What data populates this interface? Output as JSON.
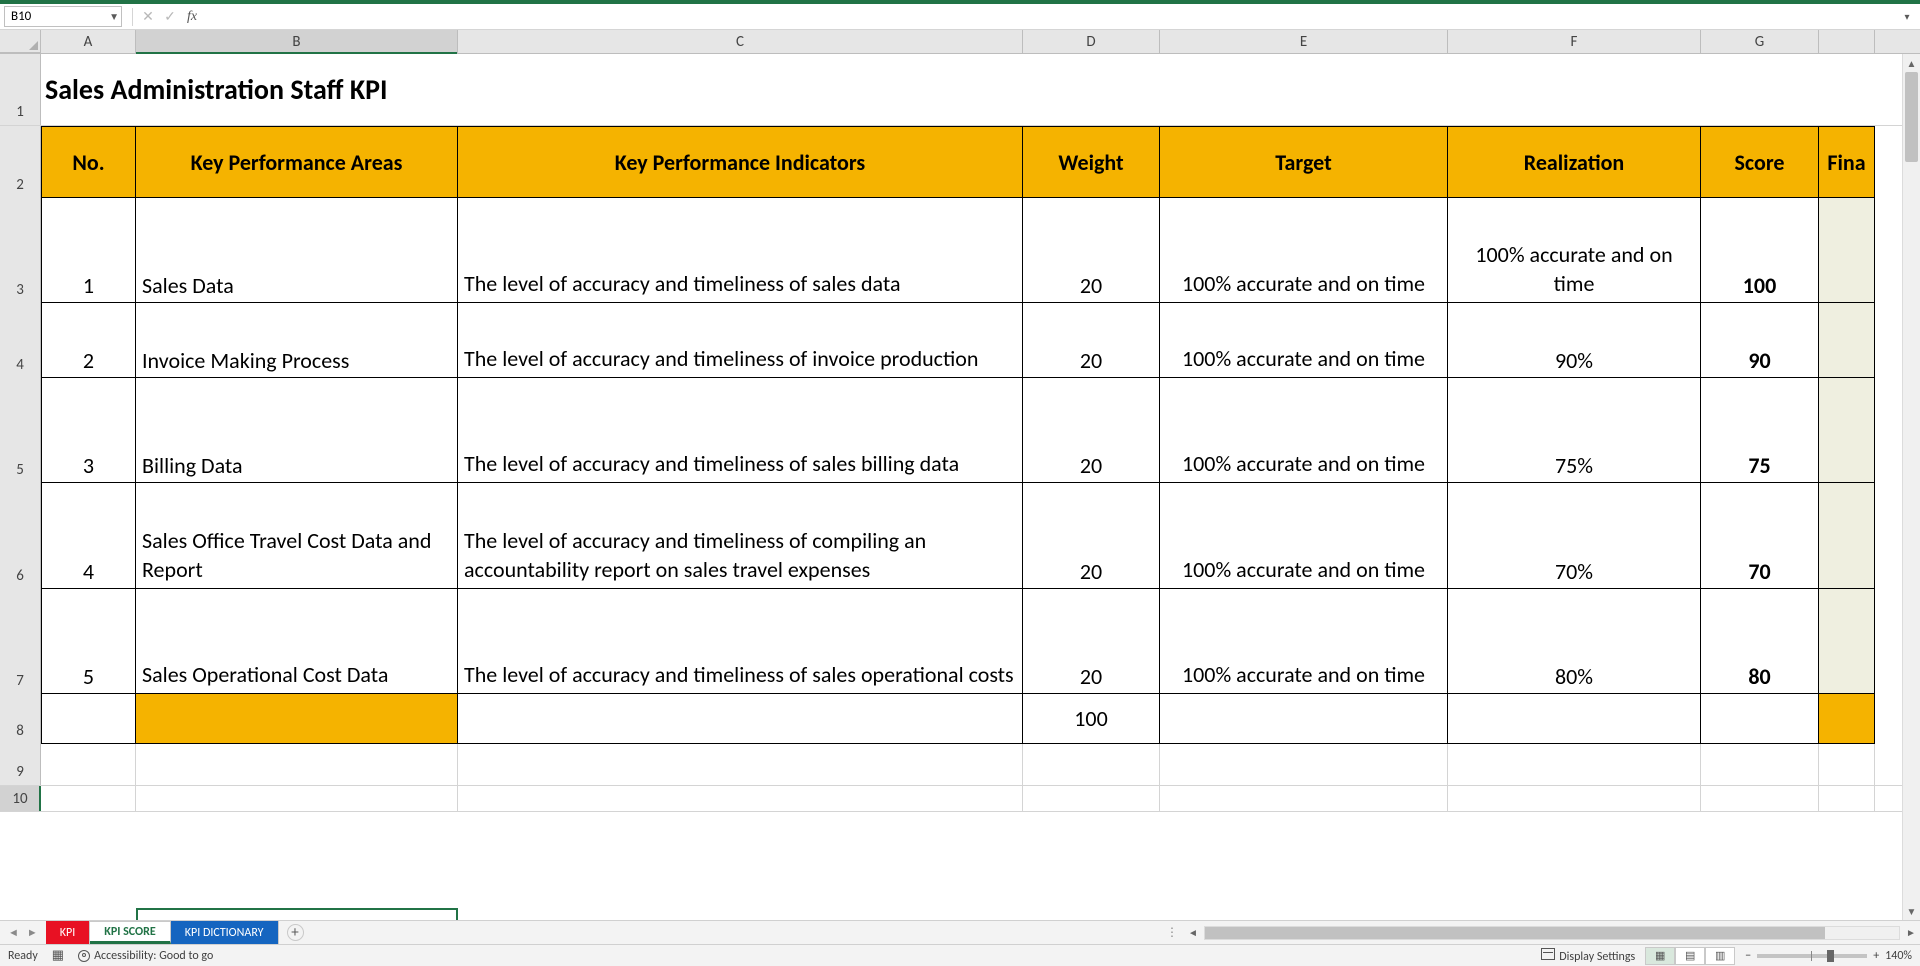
{
  "name_box": "B10",
  "formula_value": "",
  "columns": [
    "A",
    "B",
    "C",
    "D",
    "E",
    "F",
    "G"
  ],
  "partial_col_h": "Fina",
  "row_numbers": [
    "1",
    "2",
    "3",
    "4",
    "5",
    "6",
    "7",
    "8",
    "9",
    "10"
  ],
  "title": "Sales Administration Staff KPI",
  "headers": {
    "no": "No.",
    "kpa": "Key Performance Areas",
    "kpi": "Key Performance Indicators",
    "weight": "Weight",
    "target": "Target",
    "realization": "Realization",
    "score": "Score"
  },
  "rows": [
    {
      "no": "1",
      "kpa": "Sales Data",
      "kpi": "The level of accuracy and timeliness of sales data",
      "weight": "20",
      "target": "100% accurate and on time",
      "realization": "100% accurate and on time",
      "score": "100"
    },
    {
      "no": "2",
      "kpa": "Invoice Making Process",
      "kpi": "The level of accuracy and timeliness of invoice production",
      "weight": "20",
      "target": "100% accurate and on time",
      "realization": "90%",
      "score": "90"
    },
    {
      "no": "3",
      "kpa": "Billing Data",
      "kpi": "The level of accuracy and timeliness of sales billing data",
      "weight": "20",
      "target": "100% accurate and on time",
      "realization": "75%",
      "score": "75"
    },
    {
      "no": "4",
      "kpa": "Sales Office Travel Cost Data and Report",
      "kpi": "The level of accuracy and timeliness of compiling an accountability report on sales travel expenses",
      "weight": "20",
      "target": "100% accurate and on time",
      "realization": "70%",
      "score": "70"
    },
    {
      "no": "5",
      "kpa": "Sales Operational Cost Data",
      "kpi": "The level of accuracy and timeliness of sales operational costs",
      "weight": "20",
      "target": "100% accurate and on time",
      "realization": "80%",
      "score": "80"
    }
  ],
  "total_weight": "100",
  "sheet_tabs": {
    "kpi": "KPI",
    "score": "KPI SCORE",
    "dict": "KPI DICTIONARY"
  },
  "status": {
    "ready": "Ready",
    "accessibility": "Accessibility: Good to go",
    "display": "Display Settings",
    "zoom": "140%"
  },
  "chart_data": {
    "type": "table",
    "title": "Sales Administration Staff KPI",
    "columns": [
      "No.",
      "Key Performance Areas",
      "Key Performance Indicators",
      "Weight",
      "Target",
      "Realization",
      "Score"
    ],
    "rows": [
      [
        "1",
        "Sales Data",
        "The level of accuracy and timeliness of sales data",
        20,
        "100% accurate and on time",
        "100% accurate and on time",
        100
      ],
      [
        "2",
        "Invoice Making Process",
        "The level of accuracy and timeliness of invoice production",
        20,
        "100% accurate and on time",
        "90%",
        90
      ],
      [
        "3",
        "Billing Data",
        "The level of accuracy and timeliness of sales billing data",
        20,
        "100% accurate and on time",
        "75%",
        75
      ],
      [
        "4",
        "Sales Office Travel Cost Data and Report",
        "The level of accuracy and timeliness of compiling an accountability report on sales travel expenses",
        20,
        "100% accurate and on time",
        "70%",
        70
      ],
      [
        "5",
        "Sales Operational Cost Data",
        "The level of accuracy and timeliness of sales operational costs",
        20,
        "100% accurate and on time",
        "80%",
        80
      ]
    ],
    "totals": {
      "weight": 100
    }
  }
}
